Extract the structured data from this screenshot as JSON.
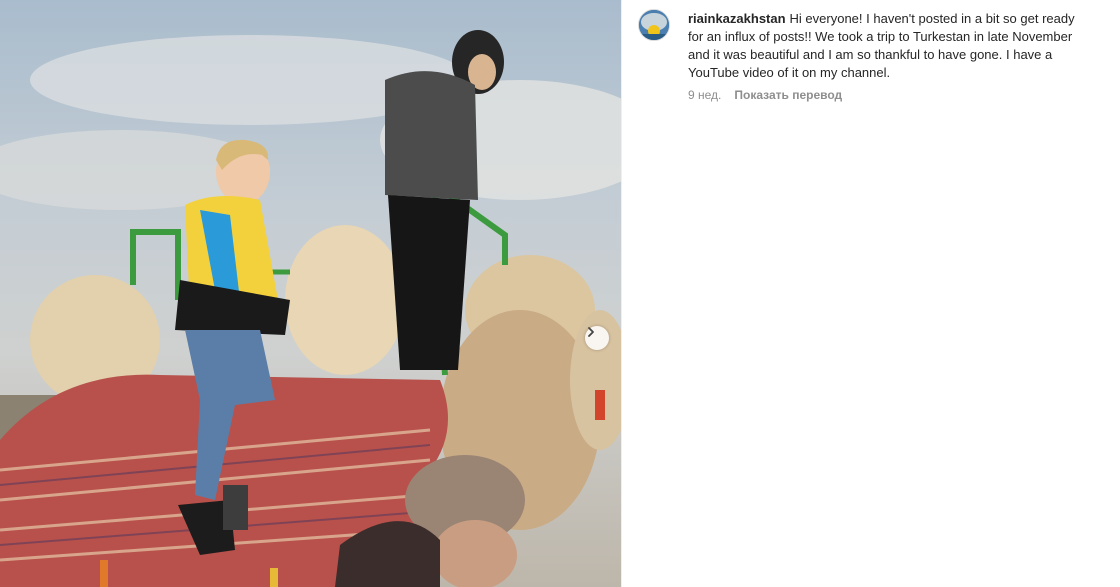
{
  "post": {
    "media": {
      "description_icon": "photo",
      "next_icon": "chevron-right-icon"
    },
    "author": {
      "username": "riainkazakhstan",
      "avatar_icon": "avatar-icon"
    },
    "caption": "Hi everyone! I haven't posted in a bit so get ready for an influx of posts!! We took a trip to Turkestan in late November and it was beautiful and I am so thankful to have gone. I have a YouTube video of it on my channel.",
    "time_ago": "9 нед.",
    "translate_label": "Показать перевод"
  },
  "colors": {
    "text": "#262626",
    "secondary": "#8e8e8e",
    "divider": "#efefef"
  }
}
